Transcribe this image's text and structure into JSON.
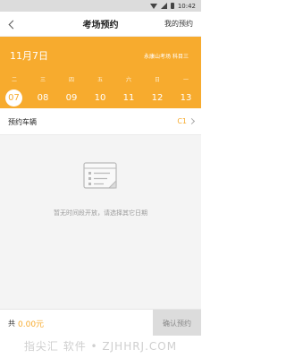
{
  "status_bar": {
    "time": "10:42",
    "icons": [
      "wifi-icon",
      "signal-icon",
      "battery-icon"
    ]
  },
  "header": {
    "back_icon": "chevron-left-icon",
    "title": "考场预约",
    "right_action": "我的预约"
  },
  "date_panel": {
    "date_title": "11月7日",
    "exam_location": "永康山考场",
    "exam_subject": "科目三",
    "weekdays": [
      "二",
      "三",
      "四",
      "五",
      "六",
      "日",
      "一"
    ],
    "days": [
      "07",
      "08",
      "09",
      "10",
      "11",
      "12",
      "13"
    ],
    "selected_day": "07",
    "accent_color": "#f7ab2e"
  },
  "vehicle": {
    "label": "预约车辆",
    "value": "C1",
    "chevron_icon": "chevron-right-icon"
  },
  "empty_state": {
    "icon": "document-list-icon",
    "message": "暂无时间段开放，请选择其它日期"
  },
  "footer": {
    "total_label": "共",
    "total_amount": "0.00元",
    "confirm_label": "确认预约"
  },
  "watermark": {
    "text": "指尖汇 软件 • ZJHHRJ.COM"
  }
}
